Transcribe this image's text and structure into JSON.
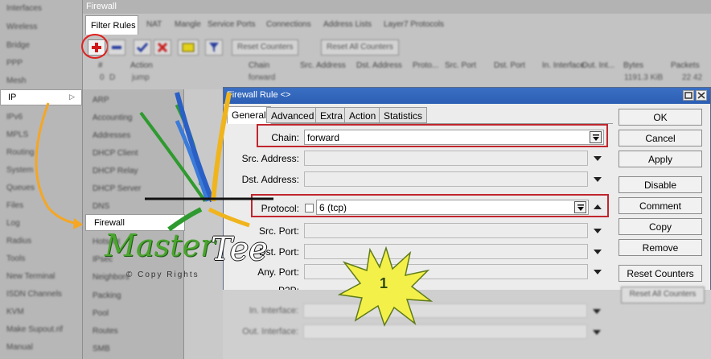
{
  "main_menu": {
    "items": [
      "Interfaces",
      "Wireless",
      "Bridge",
      "PPP",
      "Mesh",
      "IP",
      "IPv6",
      "MPLS",
      "Routing",
      "System",
      "Queues",
      "Files",
      "Log",
      "Radius",
      "Tools",
      "New Terminal",
      "ISDN Channels",
      "KVM",
      "Make Supout.rif",
      "Manual"
    ],
    "selected": "IP"
  },
  "ip_submenu": {
    "items": [
      "ARP",
      "Accounting",
      "Addresses",
      "DHCP Client",
      "DHCP Relay",
      "DHCP Server",
      "DNS",
      "Firewall",
      "Hotspot",
      "IPsec",
      "Neighbors",
      "Packing",
      "Pool",
      "Routes",
      "SMB"
    ],
    "selected": "Firewall"
  },
  "firewall_window": {
    "title": "Firewall",
    "tabs": [
      "Filter Rules",
      "NAT",
      "Mangle",
      "Service Ports",
      "Connections",
      "Address Lists",
      "Layer7 Protocols"
    ],
    "active_tab": "Filter Rules",
    "toolbar": {
      "reset_counters": "Reset Counters",
      "reset_all_counters": "Reset All Counters"
    },
    "columns": [
      "#",
      "Action",
      "Chain",
      "Src. Address",
      "Dst. Address",
      "Proto...",
      "Src. Port",
      "Dst. Port",
      "In. Interface",
      "Out. Int...",
      "Bytes",
      "Packets"
    ],
    "rows": [
      {
        "num": "0",
        "flag": "D",
        "action": "jump",
        "chain": "forward",
        "bytes": "1191.3 KiB",
        "packets": "22 42"
      }
    ]
  },
  "dialog": {
    "title": "Firewall Rule <>",
    "tabs": [
      "General",
      "Advanced",
      "Extra",
      "Action",
      "Statistics"
    ],
    "active_tab": "General",
    "fields": {
      "chain_label": "Chain:",
      "chain_value": "forward",
      "src_address_label": "Src. Address:",
      "dst_address_label": "Dst. Address:",
      "protocol_label": "Protocol:",
      "protocol_value": "6 (tcp)",
      "src_port_label": "Src. Port:",
      "dst_port_label": "Dst. Port:",
      "any_port_label": "Any. Port:",
      "p2p_label": "P2P:",
      "in_interface_label": "In. Interface:",
      "out_interface_label": "Out. Interface:"
    },
    "buttons": {
      "ok": "OK",
      "cancel": "Cancel",
      "apply": "Apply",
      "disable": "Disable",
      "comment": "Comment",
      "copy": "Copy",
      "remove": "Remove",
      "reset_counters": "Reset Counters",
      "reset_all_counters": "Reset All Counters"
    }
  },
  "watermark": {
    "master": "Master",
    "tee": "Tee",
    "copyright": "© Copy Rights"
  },
  "step_badge": "1",
  "colors": {
    "highlight_box": "#c0262e",
    "dialog_title": "#2c5fb3",
    "arrow": "#f5a623",
    "badge": "#f4f04a"
  }
}
